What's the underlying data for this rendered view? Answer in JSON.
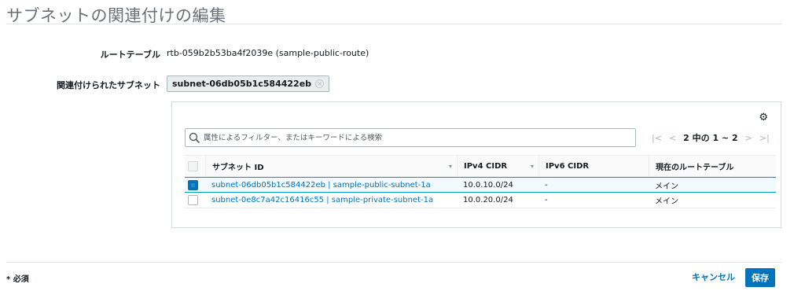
{
  "page": {
    "title": "サブネットの関連付けの編集"
  },
  "form": {
    "route_table_label": "ルートテーブル",
    "route_table_value": "rtb-059b2b53ba4f2039e (sample-public-route)",
    "associated_subnets_label": "関連付けられたサブネット",
    "selected_token": "subnet-06db05b1c584422eb"
  },
  "table": {
    "search_placeholder": "属性によるフィルター、またはキーワードによる検索",
    "pager": {
      "first": "|<",
      "prev": "<",
      "count": "2 中の 1 ~ 2",
      "next": ">",
      "last": ">|"
    },
    "columns": {
      "subnet_id": "サブネット ID",
      "ipv4": "IPv4 CIDR",
      "ipv6": "IPv6 CIDR",
      "route_table": "現在のルートテーブル"
    },
    "rows": [
      {
        "checked": true,
        "subnet_id": "subnet-06db05b1c584422eb | sample-public-subnet-1a",
        "ipv4": "10.0.10.0/24",
        "ipv6": "-",
        "route_table": "メイン"
      },
      {
        "checked": false,
        "subnet_id": "subnet-0e8c7a42c16416c55 | sample-private-subnet-1a",
        "ipv4": "10.0.20.0/24",
        "ipv6": "-",
        "route_table": "メイン"
      }
    ]
  },
  "footer": {
    "required_note": "* 必須",
    "cancel_label": "キャンセル",
    "save_label": "保存"
  },
  "colors": {
    "accent": "#0073bb",
    "selected_row_bg": "#f1faff",
    "selected_row_border": "#00a1c9"
  },
  "icons": {
    "gear": "gear-icon",
    "search": "search-icon",
    "token_remove": "close-circle-icon",
    "sort": "caret-down-icon"
  }
}
